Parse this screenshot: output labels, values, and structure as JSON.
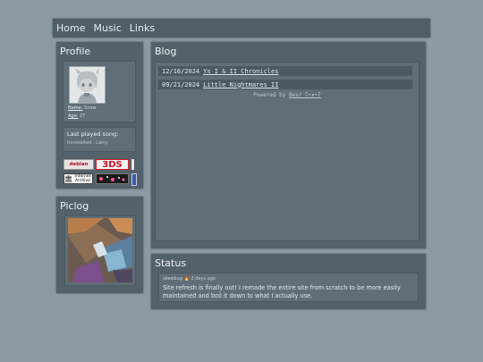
{
  "nav": {
    "items": [
      "Home",
      "Music",
      "Links"
    ]
  },
  "profile": {
    "title": "Profile",
    "name_key": "Name:",
    "name_val": "Snow",
    "age_key": "Age:",
    "age_val": "27",
    "last_played_label": "Last played song:",
    "last_played_song": "Ironmelted - Lainy"
  },
  "buttons": [
    "debian",
    "3DS",
    "Internet Archive"
  ],
  "piclog": {
    "title": "Piclog"
  },
  "blog": {
    "title": "Blog",
    "posts": [
      {
        "date": "12/16/2024",
        "title": "Ys I & II Chronicles"
      },
      {
        "date": "09/21/2024",
        "title": "Little Nightmares II"
      }
    ],
    "powered_prefix": "Powered by",
    "powered_link": "Bear ʕ•ᴥ•ʔ"
  },
  "status": {
    "title": "Status",
    "user": "skewbug",
    "time": "2 days ago",
    "text": "Site refresh is finally out! I remade the entire site from scratch to be more easily maintained and boil it down to what I actually use."
  },
  "colors": {
    "page_bg": "#8c9ba3",
    "panel": "#52616a",
    "inner": "#5f6e77",
    "nav": "#4f5e67"
  }
}
